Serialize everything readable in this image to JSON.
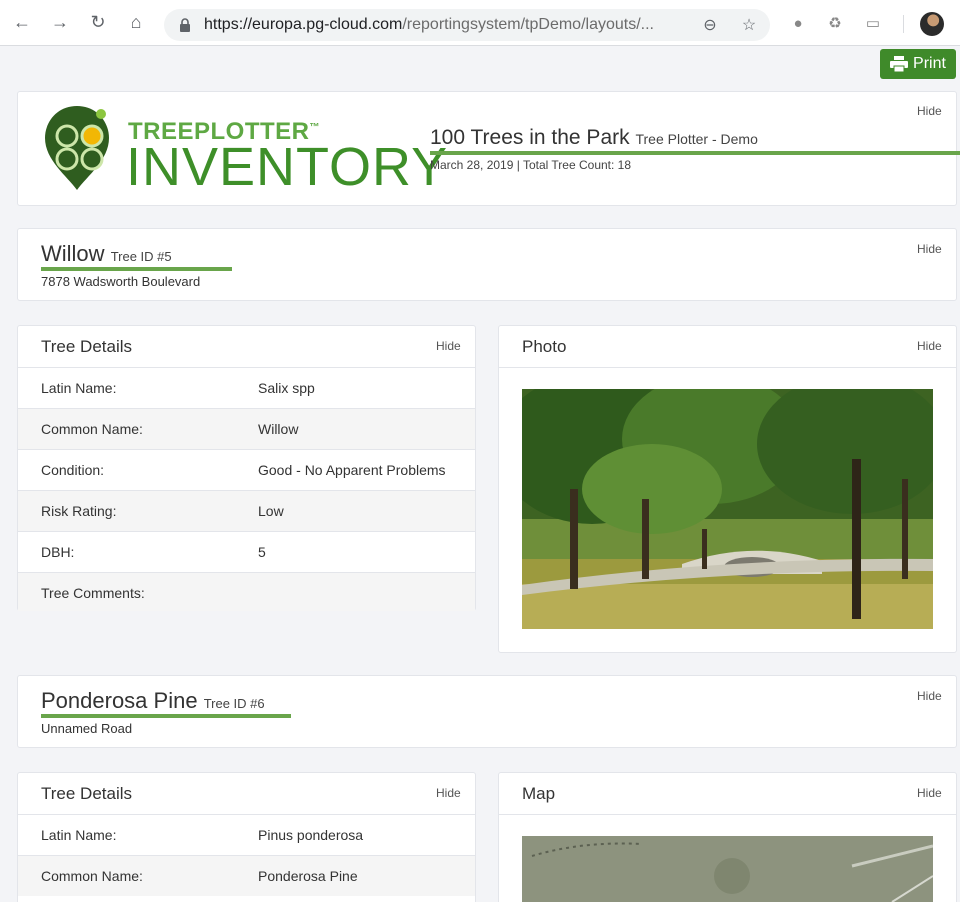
{
  "browser": {
    "url_host": "https://europa.pg-cloud.com",
    "url_path": "/reportingsystem/tpDemo/layouts/..."
  },
  "print_label": "Print",
  "header": {
    "logo_top": "TREEPLOTTER",
    "logo_tm": "™",
    "logo_bottom": "INVENTORY",
    "title": "100 Trees in the Park",
    "subtitle": "Tree Plotter - Demo",
    "meta": "March 28, 2019 | Total Tree Count: 18",
    "hide": "Hide"
  },
  "trees": [
    {
      "name": "Willow",
      "tree_id": "Tree ID #5",
      "address": "7878 Wadsworth Boulevard",
      "hide": "Hide",
      "details_title": "Tree Details",
      "details_hide": "Hide",
      "details": [
        {
          "label": "Latin Name:",
          "value": "Salix spp"
        },
        {
          "label": "Common Name:",
          "value": "Willow"
        },
        {
          "label": "Condition:",
          "value": "Good - No Apparent Problems"
        },
        {
          "label": "Risk Rating:",
          "value": "Low"
        },
        {
          "label": "DBH:",
          "value": "5"
        },
        {
          "label": "Tree Comments:",
          "value": ""
        }
      ],
      "media_title": "Photo",
      "media_hide": "Hide"
    },
    {
      "name": "Ponderosa Pine",
      "tree_id": "Tree ID #6",
      "address": "Unnamed Road",
      "hide": "Hide",
      "details_title": "Tree Details",
      "details_hide": "Hide",
      "details": [
        {
          "label": "Latin Name:",
          "value": "Pinus ponderosa"
        },
        {
          "label": "Common Name:",
          "value": "Ponderosa Pine"
        }
      ],
      "media_title": "Map",
      "media_hide": "Hide"
    }
  ],
  "colors": {
    "brand_green": "#3f8a2a",
    "accent_line": "#69a54b"
  }
}
